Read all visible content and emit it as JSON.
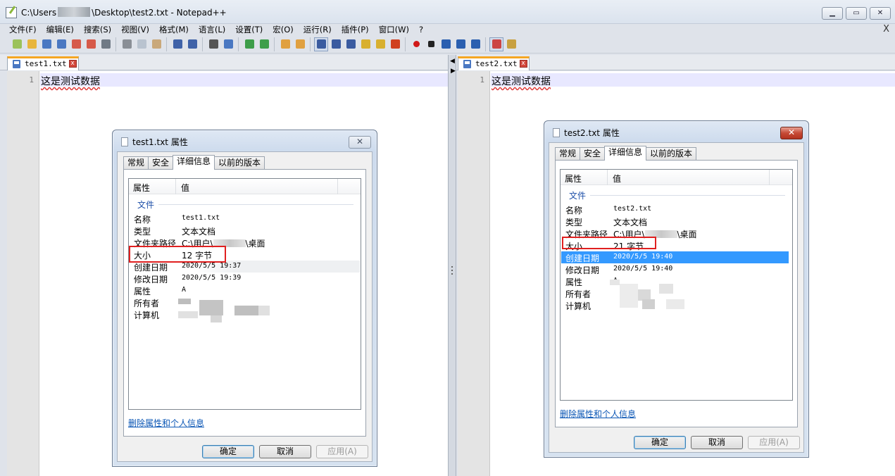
{
  "window": {
    "title_prefix": "C:\\Users",
    "title_suffix": "\\Desktop\\test2.txt - Notepad++",
    "min_label": "▁",
    "max_label": "▭",
    "close_label": "✕"
  },
  "menu": {
    "items": [
      "文件(F)",
      "编辑(E)",
      "搜索(S)",
      "视图(V)",
      "格式(M)",
      "语言(L)",
      "设置(T)",
      "宏(O)",
      "运行(R)",
      "插件(P)",
      "窗口(W)",
      "?"
    ],
    "close_label": "X"
  },
  "toolbar": {
    "icons": [
      "new-file-icon",
      "open-file-icon",
      "save-icon",
      "save-all-icon",
      "close-icon",
      "close-all-icon",
      "print-icon",
      "cut-icon",
      "copy-icon",
      "paste-icon",
      "undo-icon",
      "redo-icon",
      "find-icon",
      "replace-icon",
      "zoom-in-icon",
      "zoom-out-icon",
      "sync-vertical-icon",
      "sync-horizontal-icon",
      "word-wrap-icon",
      "show-all-chars-icon",
      "indent-guide-icon",
      "doc-map-icon",
      "function-list-icon",
      "folder-workspace-icon",
      "record-macro-icon",
      "stop-record-icon",
      "play-macro-icon",
      "run-macro-multiple-icon",
      "save-macro-icon",
      "spell-check-icon",
      "spell-options-icon"
    ]
  },
  "left_pane": {
    "tab_label": "test1.txt",
    "line_number": "1",
    "line_text": "这是测试数据"
  },
  "right_pane": {
    "tab_label": "test2.txt",
    "line_number": "1",
    "line_text": "这是测试数据"
  },
  "dialog1": {
    "title": "test1.txt 属性",
    "close_label": "✕",
    "tabs": [
      "常规",
      "安全",
      "详细信息",
      "以前的版本"
    ],
    "col_property": "属性",
    "col_value": "值",
    "group": "文件",
    "rows": [
      {
        "k": "名称",
        "v": "test1.txt"
      },
      {
        "k": "类型",
        "v": "文本文档"
      },
      {
        "k": "文件夹路径",
        "v": "C:\\用户\\",
        "v2": "\\桌面"
      },
      {
        "k": "大小",
        "v": "12 字节"
      },
      {
        "k": "创建日期",
        "v": "2020/5/5 19:37"
      },
      {
        "k": "修改日期",
        "v": "2020/5/5 19:39"
      },
      {
        "k": "属性",
        "v": "A"
      },
      {
        "k": "所有者",
        "v": ""
      },
      {
        "k": "计算机",
        "v": ""
      }
    ],
    "link": "删除属性和个人信息",
    "ok": "确定",
    "cancel": "取消",
    "apply": "应用(A)"
  },
  "dialog2": {
    "title": "test2.txt 属性",
    "close_label": "✕",
    "tabs": [
      "常规",
      "安全",
      "详细信息",
      "以前的版本"
    ],
    "col_property": "属性",
    "col_value": "值",
    "group": "文件",
    "rows": [
      {
        "k": "名称",
        "v": "test2.txt"
      },
      {
        "k": "类型",
        "v": "文本文档"
      },
      {
        "k": "文件夹路径",
        "v": "C:\\用户\\",
        "v2": "\\桌面"
      },
      {
        "k": "大小",
        "v": "21 字节"
      },
      {
        "k": "创建日期",
        "v": "2020/5/5 19:40"
      },
      {
        "k": "修改日期",
        "v": "2020/5/5 19:40"
      },
      {
        "k": "属性",
        "v": "A"
      },
      {
        "k": "所有者",
        "v": ""
      },
      {
        "k": "计算机",
        "v": ""
      }
    ],
    "link": "删除属性和个人信息",
    "ok": "确定",
    "cancel": "取消",
    "apply": "应用(A)"
  },
  "colors": {
    "tab_accent": "#f5a623",
    "highlight_row": "#3399ff",
    "annotation_red": "#e02020",
    "link": "#0a56b5"
  }
}
